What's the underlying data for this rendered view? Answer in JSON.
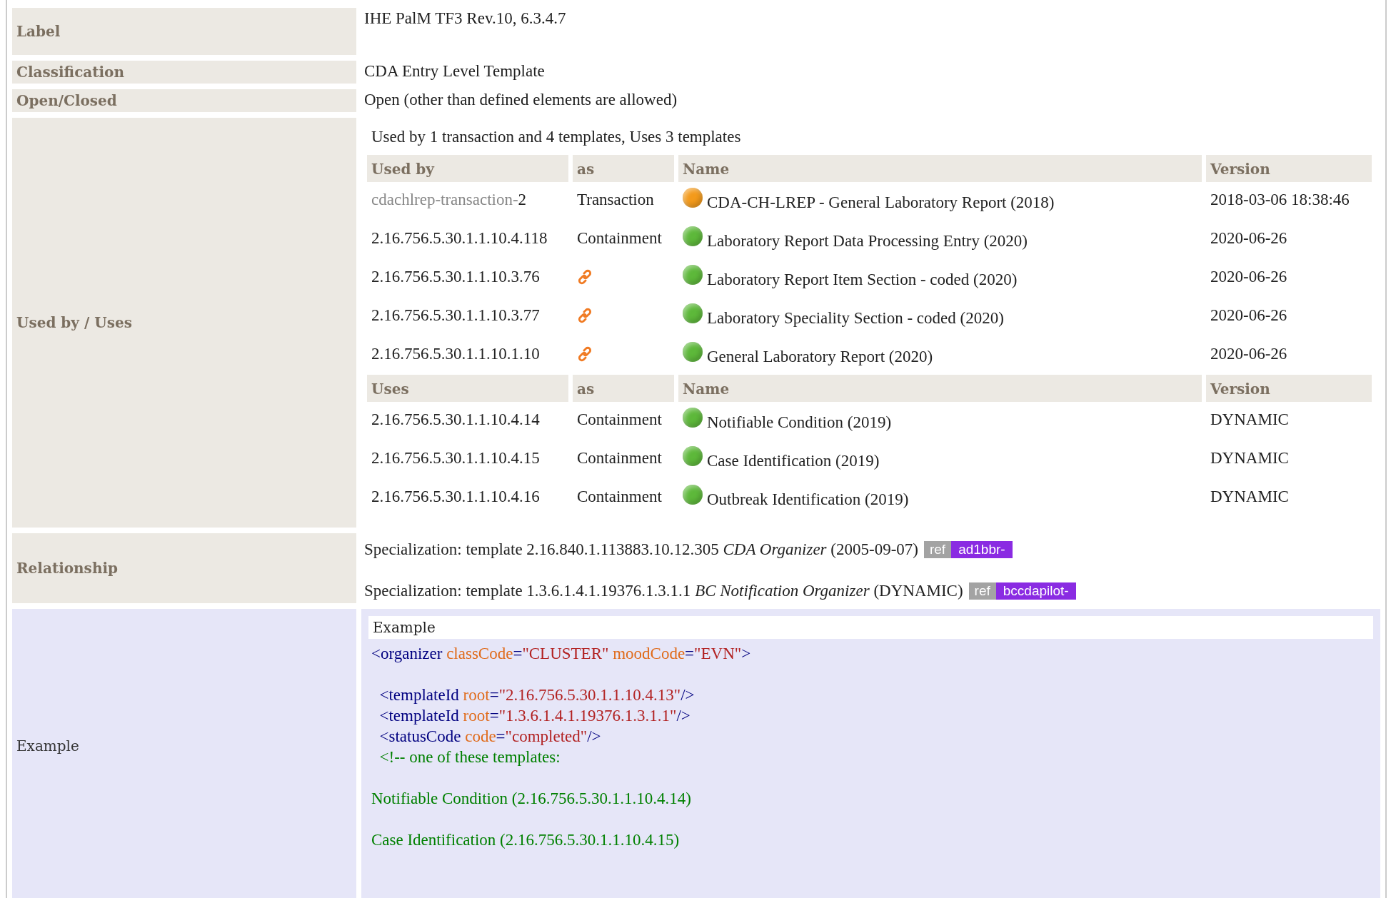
{
  "properties": [
    {
      "label": "Label",
      "value": "IHE PalM TF3 Rev.10, 6.3.4.7"
    },
    {
      "label": "Classification",
      "value": "CDA Entry Level Template"
    },
    {
      "label": "Open/Closed",
      "value": "Open (other than defined elements are allowed)"
    }
  ],
  "usage": {
    "label": "Used by / Uses",
    "summary": "Used by 1 transaction and 4 templates, Uses 3 templates",
    "sections": [
      {
        "columns": [
          "Used by",
          "as",
          "Name",
          "Version"
        ],
        "rows": [
          {
            "id_prefix": "cdachlrep-transaction-",
            "id": "2",
            "kind": "text",
            "as": "Transaction",
            "color": "#f39a1b",
            "name": "CDA-CH-LREP - General Laboratory Report (2018)",
            "version": "2018-03-06 18:38:46"
          },
          {
            "id": "2.16.756.5.30.1.1.10.4.118",
            "kind": "text",
            "as": "Containment",
            "color": "#5db83a",
            "name": "Laboratory Report Data Processing Entry (2020)",
            "version": "2020-06-26"
          },
          {
            "id": "2.16.756.5.30.1.1.10.3.76",
            "kind": "link",
            "color": "#5db83a",
            "name": "Laboratory Report Item Section - coded (2020)",
            "version": "2020-06-26"
          },
          {
            "id": "2.16.756.5.30.1.1.10.3.77",
            "kind": "link",
            "color": "#5db83a",
            "name": "Laboratory Speciality Section - coded (2020)",
            "version": "2020-06-26"
          },
          {
            "id": "2.16.756.5.30.1.1.10.1.10",
            "kind": "link",
            "color": "#5db83a",
            "name": "General Laboratory Report (2020)",
            "version": "2020-06-26"
          }
        ]
      },
      {
        "columns": [
          "Uses",
          "as",
          "Name",
          "Version"
        ],
        "rows": [
          {
            "id": "2.16.756.5.30.1.1.10.4.14",
            "kind": "text",
            "as": "Containment",
            "color": "#5db83a",
            "name": "Notifiable Condition (2019)",
            "version": "DYNAMIC"
          },
          {
            "id": "2.16.756.5.30.1.1.10.4.15",
            "kind": "text",
            "as": "Containment",
            "color": "#5db83a",
            "name": "Case Identification (2019)",
            "version": "DYNAMIC"
          },
          {
            "id": "2.16.756.5.30.1.1.10.4.16",
            "kind": "text",
            "as": "Containment",
            "color": "#5db83a",
            "name": "Outbreak Identification (2019)",
            "version": "DYNAMIC"
          }
        ]
      }
    ]
  },
  "relationship": {
    "label": "Relationship",
    "items": [
      {
        "text": "Specialization: template 2.16.840.1.113883.10.12.305 *CDA Organizer* (2005-09-07)",
        "badge_label": "ref",
        "badge_value": "ad1bbr-"
      },
      {
        "text": "Specialization: template 1.3.6.1.4.1.19376.1.3.1.1 *BC Notification Organizer* (DYNAMIC)",
        "badge_label": "ref",
        "badge_value": "bccdapilot-"
      }
    ]
  },
  "example": {
    "label": "Example",
    "title": "Example",
    "lines": [
      {
        "kind": "code",
        "tokens": [
          {
            "kind": "tag",
            "text": "<organizer"
          },
          {
            "kind": "attr",
            "text": " classCode"
          },
          {
            "kind": "tag",
            "text": "="
          },
          {
            "kind": "value",
            "text": "\"CLUSTER\""
          },
          {
            "kind": "attr",
            "text": " moodCode"
          },
          {
            "kind": "tag",
            "text": "="
          },
          {
            "kind": "value",
            "text": "\"EVN\""
          },
          {
            "kind": "tag",
            "text": ">"
          }
        ]
      },
      {
        "kind": "blank"
      },
      {
        "kind": "code",
        "tokens": [
          {
            "kind": "tag",
            "text": "  <templateId"
          },
          {
            "kind": "attr",
            "text": " root"
          },
          {
            "kind": "tag",
            "text": "="
          },
          {
            "kind": "value",
            "text": "\"2.16.756.5.30.1.1.10.4.13\""
          },
          {
            "kind": "tag",
            "text": "/>"
          }
        ]
      },
      {
        "kind": "code",
        "tokens": [
          {
            "kind": "tag",
            "text": "  <templateId"
          },
          {
            "kind": "attr",
            "text": " root"
          },
          {
            "kind": "tag",
            "text": "="
          },
          {
            "kind": "value",
            "text": "\"1.3.6.1.4.1.19376.1.3.1.1\""
          },
          {
            "kind": "tag",
            "text": "/>"
          }
        ]
      },
      {
        "kind": "code",
        "tokens": [
          {
            "kind": "tag",
            "text": "  <statusCode"
          },
          {
            "kind": "attr",
            "text": " code"
          },
          {
            "kind": "tag",
            "text": "="
          },
          {
            "kind": "value",
            "text": "\"completed\""
          },
          {
            "kind": "tag",
            "text": "/>"
          }
        ]
      },
      {
        "kind": "code",
        "tokens": [
          {
            "kind": "comment",
            "text": "  <!-- one of these templates:"
          }
        ]
      },
      {
        "kind": "blank"
      },
      {
        "kind": "code",
        "tokens": [
          {
            "kind": "comment",
            "text": "Notifiable Condition (2.16.756.5.30.1.1.10.4.14)"
          }
        ]
      },
      {
        "kind": "blank"
      },
      {
        "kind": "code",
        "tokens": [
          {
            "kind": "comment",
            "text": "Case Identification (2.16.756.5.30.1.1.10.4.15)"
          }
        ]
      }
    ]
  }
}
